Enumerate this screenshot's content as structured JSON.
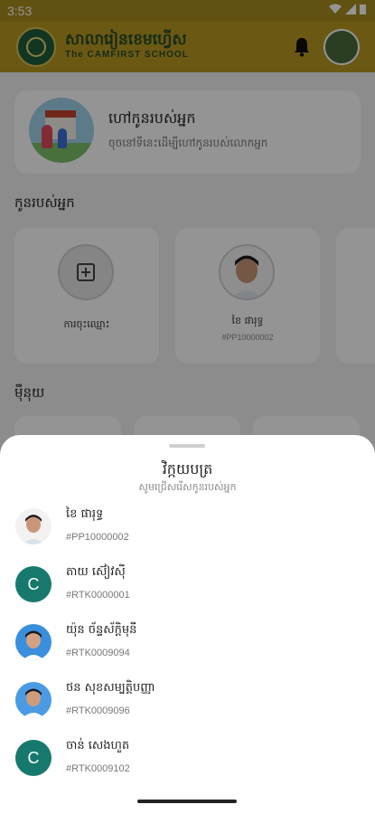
{
  "status_bar": {
    "time": "3:53"
  },
  "header": {
    "school_name": "សាលារៀនខេមហ្វើស",
    "school_subtitle": "The CAMFIRST SCHOOL"
  },
  "find_card": {
    "title": "ហៅកូនរបស់អ្នក",
    "description": "ចុចនៅទីនេះដើម្បីហៅកូនរបស់លោកអ្នក"
  },
  "kids_section": {
    "title": "កូនរបស់អ្នក",
    "add_label": "ការចុះឈ្មោះ",
    "child": {
      "name": "ខៃ ផារុទ្ធ",
      "id": "#PP10000002"
    }
  },
  "menu_section": {
    "title": "ម៉ឺនុយ"
  },
  "sheet": {
    "title": "វិក្កយបត្រ",
    "subtitle": "សូមជ្រើសរើសកូនរបស់អ្នក",
    "students": [
      {
        "name": "ខៃ ផារុទ្ធ",
        "id": "#PP10000002",
        "avatar": "photo",
        "initial": ""
      },
      {
        "name": "តាយ ស៊ៀវស៊ី",
        "id": "#RTK0000001",
        "avatar": "letter",
        "initial": "C"
      },
      {
        "name": "យ៉ុន ច័ន្ទស័ក្តិមុនី",
        "id": "#RTK0009094",
        "avatar": "photo",
        "initial": ""
      },
      {
        "name": "ថន សុខសម្បត្តិបញ្ញា",
        "id": "#RTK0009096",
        "avatar": "photo",
        "initial": ""
      },
      {
        "name": "ចាន់ សេងហួត",
        "id": "#RTK0009102",
        "avatar": "letter",
        "initial": "C"
      }
    ]
  },
  "colors": {
    "app_bar": "#b89a22",
    "avatar_letter_bg": "#17796e",
    "sheet_bg": "#ffffff"
  },
  "icons": [
    "wifi-icon",
    "signal-icon",
    "battery-icon",
    "notification-bell-icon",
    "grid-add-icon"
  ]
}
